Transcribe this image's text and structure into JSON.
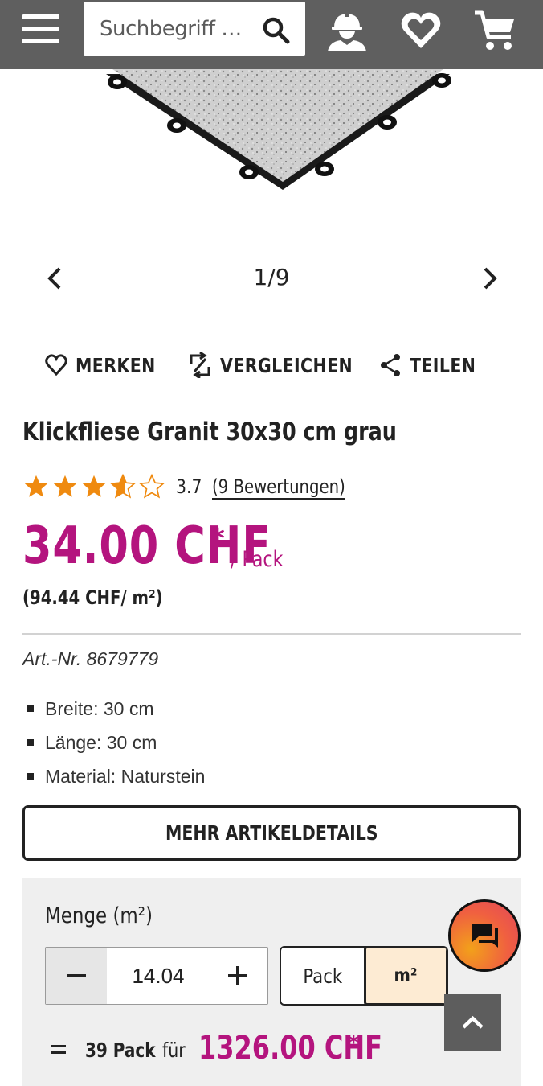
{
  "header": {
    "search_placeholder": "Suchbegriff …",
    "icons": [
      "menu-icon",
      "search-icon",
      "user-helmet-icon",
      "heart-icon",
      "cart-icon"
    ]
  },
  "carousel": {
    "counter": "1/9"
  },
  "actions": {
    "save": "MERKEN",
    "compare": "VERGLEICHEN",
    "share": "TEILEN"
  },
  "product": {
    "title": "Klickfliese Granit 30x30 cm grau",
    "rating": 3.7,
    "rating_text": "3.7",
    "reviews_link": "(9 Bewertungen)",
    "price": "34.00 CHF",
    "price_asterisk": "*",
    "price_unit": "/ Pack",
    "base_price": "(94.44 CHF/ m²)",
    "article_number": "Art.-Nr. 8679779",
    "specs": [
      "Breite: 30 cm",
      "Länge: 30 cm",
      "Material: Naturstein"
    ],
    "more_details": "MEHR ARTIKELDETAILS"
  },
  "quantity": {
    "label": "Menge (m²)",
    "value": "14.04",
    "units": [
      "Pack",
      "m²"
    ],
    "selected_unit": "m²",
    "total_qty": "39 Pack",
    "total_for": "für",
    "total_price": "1326.00 CHF",
    "total_asterisk": "*"
  },
  "colors": {
    "accent": "#b4147e",
    "header_bg": "#5f5f5f",
    "selected_unit_bg": "#fdebd3"
  }
}
